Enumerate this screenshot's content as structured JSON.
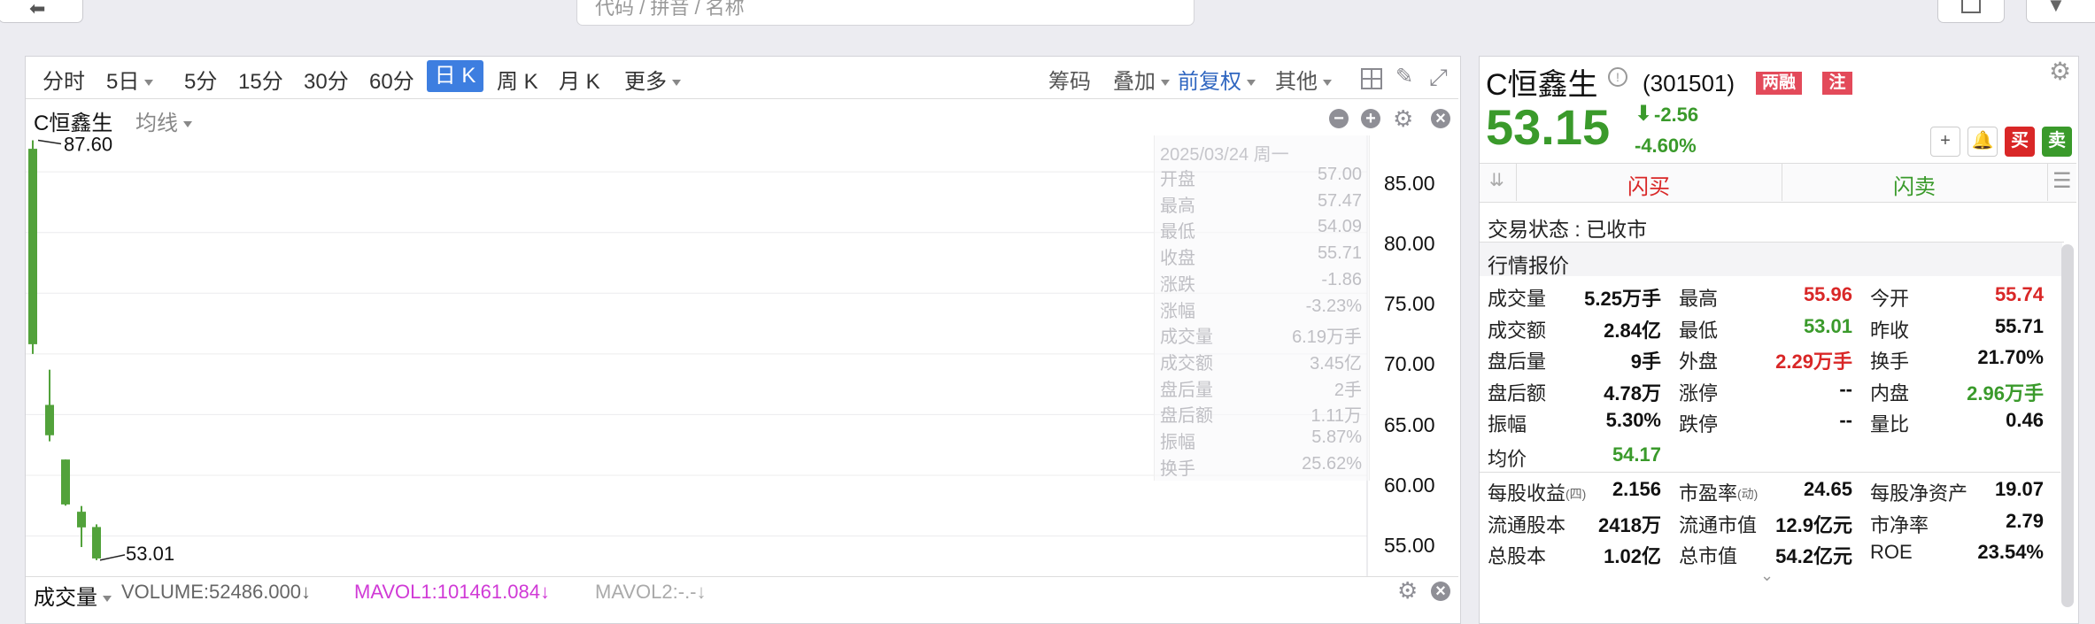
{
  "top": {
    "search_placeholder": "代码 / 拼音 / 名称"
  },
  "toolbar": {
    "periods": [
      "分时",
      "5日",
      "5分",
      "15分",
      "30分",
      "60分",
      "日 K",
      "周 K",
      "月 K",
      "更多"
    ],
    "active_period": "日 K",
    "right_tools": [
      "筹码",
      "叠加",
      "前复权",
      "其他"
    ]
  },
  "chart_header": {
    "stock": "C恒鑫生",
    "indicator": "均线"
  },
  "chart_data": {
    "type": "candlestick",
    "y_axis_ticks": [
      "85.00",
      "80.00",
      "75.00",
      "70.00",
      "65.00",
      "60.00",
      "55.00"
    ],
    "ylim": [
      53.0,
      88.0
    ],
    "candles": [
      {
        "open": 86.9,
        "high": 87.6,
        "low": 70.0,
        "close": 70.8,
        "color": "green"
      },
      {
        "open": 65.8,
        "high": 68.7,
        "low": 62.8,
        "close": 63.3,
        "color": "green"
      },
      {
        "open": 61.3,
        "high": 61.3,
        "low": 57.5,
        "close": 57.6,
        "color": "green"
      },
      {
        "open": 57.0,
        "high": 57.47,
        "low": 54.09,
        "close": 55.71,
        "color": "green"
      },
      {
        "open": 55.74,
        "high": 55.96,
        "low": 53.01,
        "close": 53.15,
        "color": "green"
      }
    ],
    "annotations": {
      "high_label": "87.60",
      "low_label": "53.01"
    }
  },
  "hover_info": {
    "date": "2025/03/24 周一",
    "rows": [
      {
        "k": "开盘",
        "v": "57.00"
      },
      {
        "k": "最高",
        "v": "57.47"
      },
      {
        "k": "最低",
        "v": "54.09"
      },
      {
        "k": "收盘",
        "v": "55.71"
      },
      {
        "k": "涨跌",
        "v": "-1.86"
      },
      {
        "k": "涨幅",
        "v": "-3.23%"
      },
      {
        "k": "成交量",
        "v": "6.19万手"
      },
      {
        "k": "成交额",
        "v": "3.45亿"
      },
      {
        "k": "盘后量",
        "v": "2手"
      },
      {
        "k": "盘后额",
        "v": "1.11万"
      },
      {
        "k": "振幅",
        "v": "5.87%"
      },
      {
        "k": "换手",
        "v": "25.62%"
      }
    ]
  },
  "volume_bar": {
    "label": "成交量",
    "volume": "VOLUME:52486.000↓",
    "mavol1": "MAVOL1:101461.084↓",
    "mavol2": "MAVOL2:-.-↓"
  },
  "quote": {
    "name": "C恒鑫生",
    "code": "(301501)",
    "badge1": "两融",
    "badge2": "注",
    "price": "53.15",
    "change": "-2.56",
    "change_pct": "-4.60%",
    "buy_label": "买",
    "sell_label": "卖",
    "flash_buy": "闪买",
    "flash_sell": "闪卖",
    "status": "交易状态 : 已收市",
    "section_title": "行情报价",
    "grid": [
      [
        {
          "k": "成交量",
          "v": "5.25万手",
          "c": "black"
        },
        {
          "k": "最高",
          "v": "55.96",
          "c": "red"
        },
        {
          "k": "今开",
          "v": "55.74",
          "c": "red"
        }
      ],
      [
        {
          "k": "成交额",
          "v": "2.84亿",
          "c": "black"
        },
        {
          "k": "最低",
          "v": "53.01",
          "c": "green"
        },
        {
          "k": "昨收",
          "v": "55.71",
          "c": "black"
        }
      ],
      [
        {
          "k": "盘后量",
          "v": "9手",
          "c": "black"
        },
        {
          "k": "外盘",
          "v": "2.29万手",
          "c": "red"
        },
        {
          "k": "换手",
          "v": "21.70%",
          "c": "black"
        }
      ],
      [
        {
          "k": "盘后额",
          "v": "4.78万",
          "c": "black"
        },
        {
          "k": "涨停",
          "v": "--",
          "c": "black"
        },
        {
          "k": "内盘",
          "v": "2.96万手",
          "c": "green"
        }
      ],
      [
        {
          "k": "振幅",
          "v": "5.30%",
          "c": "black"
        },
        {
          "k": "跌停",
          "v": "--",
          "c": "black"
        },
        {
          "k": "量比",
          "v": "0.46",
          "c": "black"
        }
      ]
    ],
    "avg_label": "均价",
    "avg_value": "54.17",
    "grid2": [
      [
        {
          "k": "每股收益",
          "sub": "(四)",
          "v": "2.156"
        },
        {
          "k": "市盈率",
          "sub": "(动)",
          "v": "24.65"
        },
        {
          "k": "每股净资产",
          "v": "19.07"
        }
      ],
      [
        {
          "k": "流通股本",
          "v": "2418万"
        },
        {
          "k": "流通市值",
          "v": "12.9亿元"
        },
        {
          "k": "市净率",
          "v": "2.79"
        }
      ],
      [
        {
          "k": "总股本",
          "v": "1.02亿"
        },
        {
          "k": "总市值",
          "v": "54.2亿元"
        },
        {
          "k": "ROE",
          "v": "23.54%"
        }
      ]
    ]
  }
}
